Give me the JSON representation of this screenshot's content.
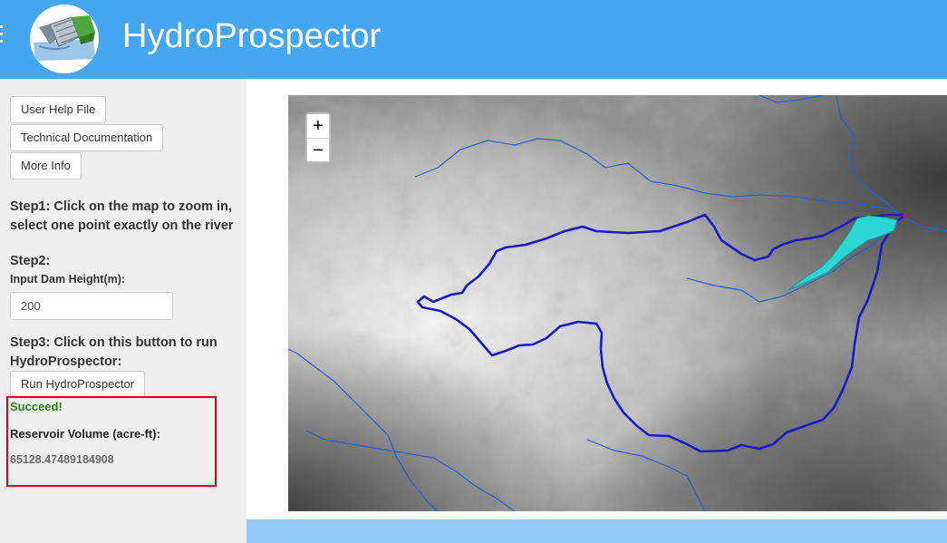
{
  "header": {
    "title": "HydroProspector",
    "menu_icon": "hamburger-icon",
    "logo_icon": "dam-logo-icon",
    "background_color": "#45a6f2"
  },
  "sidebar": {
    "buttons": {
      "help": "User Help File",
      "docs": "Technical Documentation",
      "info": "More Info"
    },
    "step1": "Step1: Click on the map to zoom in, select one point exactly on the river",
    "step2": "Step2:",
    "dam_height_label": "Input Dam Height(m):",
    "dam_height_value": "200",
    "step3": "Step3: Click on this button to run HydroProspector:",
    "run_button": "Run HydroProspector",
    "status": "Succeed!",
    "volume_label": "Reservoir Volume (acre-ft):",
    "volume_value": "65128.47489184908",
    "status_color": "#1a8a1a",
    "highlight_color": "#e0001a"
  },
  "map": {
    "zoom_in": "+",
    "zoom_out": "−",
    "river_color": "#1f63d6",
    "watershed_color": "#1a1ac8",
    "reservoir_color": "#2ad6d6"
  }
}
